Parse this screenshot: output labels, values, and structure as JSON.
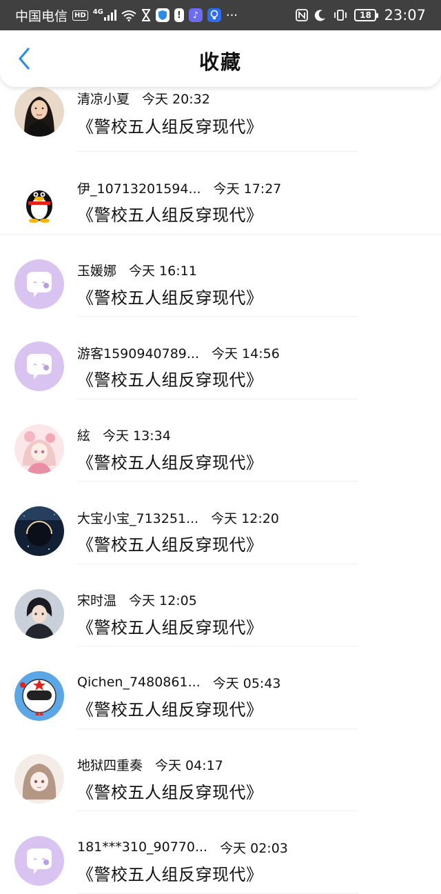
{
  "status_bar": {
    "carrier": "中国电信",
    "hd": "HD",
    "network": "4G",
    "battery": "18",
    "time": "23:07"
  },
  "header": {
    "title": "收藏",
    "accent": "#2b8ce8"
  },
  "items": [
    {
      "name": "清凉小夏",
      "time": "今天 20:32",
      "book": "《警校五人组反穿现代》",
      "avatar": "photo-girl"
    },
    {
      "name": "伊_10713201594...",
      "time": "今天 17:27",
      "book": "《警校五人组反穿现代》",
      "avatar": "qq-penguin"
    },
    {
      "name": "玉媛娜",
      "time": "今天 16:11",
      "book": "《警校五人组反穿现代》",
      "avatar": "default-chat"
    },
    {
      "name": "游客1590940789...",
      "time": "今天 14:56",
      "book": "《警校五人组反穿现代》",
      "avatar": "default-chat"
    },
    {
      "name": "絃",
      "time": "今天 13:34",
      "book": "《警校五人组反穿现代》",
      "avatar": "anime-pink"
    },
    {
      "name": "大宝小宝_713251...",
      "time": "今天 12:20",
      "book": "《警校五人组反穿现代》",
      "avatar": "night-planet"
    },
    {
      "name": "宋时温",
      "time": "今天 12:05",
      "book": "《警校五人组反穿现代》",
      "avatar": "anime-boy"
    },
    {
      "name": "Qichen_7480861...",
      "time": "今天 05:43",
      "book": "《警校五人组反穿现代》",
      "avatar": "astronaut-helmet"
    },
    {
      "name": "地狱四重奏",
      "time": "今天 04:17",
      "book": "《警校五人组反穿现代》",
      "avatar": "anime-girl-brown"
    },
    {
      "name": "181***310_90770...",
      "time": "今天 02:03",
      "book": "《警校五人组反穿现代》",
      "avatar": "default-chat"
    }
  ]
}
